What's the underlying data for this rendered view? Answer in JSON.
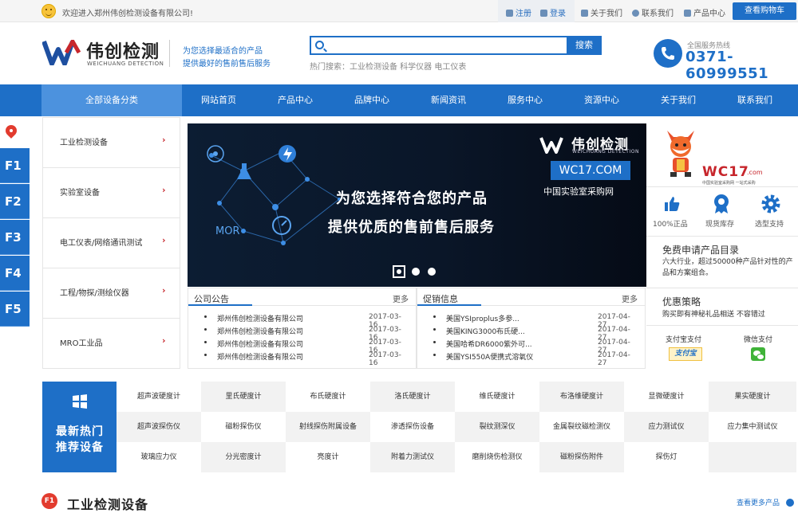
{
  "topbar": {
    "welcome": "欢迎进入郑州伟创检测设备有限公司!",
    "register": "注册",
    "login": "登录",
    "about": "关于我们",
    "contact": "联系我们",
    "products": "产品中心",
    "cart": "查看购物车"
  },
  "header": {
    "logo_cn": "伟创检测",
    "logo_en": "WEICHUANG DETECTION",
    "slogan1": "为您选择最适合的产品",
    "slogan2": "提供最好的售前售后服务",
    "search_placeholder": "",
    "search_button": "搜索",
    "hot_search": "热门搜索：工业检测设备  科学仪器  电工仪表",
    "hotline_label": "全国服务热线",
    "hotline": "0371-60999551"
  },
  "nav": {
    "all": "全部设备分类",
    "items": [
      "网站首页",
      "产品中心",
      "品牌中心",
      "新闻资讯",
      "服务中心",
      "资源中心",
      "关于我们",
      "联系我们"
    ]
  },
  "floors": [
    "F1",
    "F2",
    "F3",
    "F4",
    "F5"
  ],
  "categories": [
    "工业检测设备",
    "实验室设备",
    "电工仪表/网络通讯测试",
    "工程/物探/测绘仪器",
    "MRO工业品"
  ],
  "banner": {
    "brand": "伟创检测",
    "brand_en": "WEICHUANG DETECTION",
    "url": "WC17.COM",
    "sub": "中国实验室采购网",
    "headline1": "为您选择符合您的产品",
    "headline2": "提供优质的售前售后服务",
    "mor": "MOR"
  },
  "notice": {
    "title": "公司公告",
    "more": "更多",
    "items": [
      {
        "text": "郑州伟创检测设备有限公司",
        "date": "2017-03-16"
      },
      {
        "text": "郑州伟创检测设备有限公司",
        "date": "2017-03-16"
      },
      {
        "text": "郑州伟创检测设备有限公司",
        "date": "2017-03-16"
      },
      {
        "text": "郑州伟创检测设备有限公司",
        "date": "2017-03-16"
      }
    ]
  },
  "promo": {
    "title": "促销信息",
    "more": "更多",
    "items": [
      {
        "text": "美国YSIproplus多参...",
        "date": "2017-04-27"
      },
      {
        "text": "美国KING3000布氏硬...",
        "date": "2017-04-27"
      },
      {
        "text": "美国哈希DR6000紫外可...",
        "date": "2017-04-27"
      },
      {
        "text": "美国YSI550A便携式溶氧仪",
        "date": "2017-04-27"
      }
    ]
  },
  "rightside": {
    "wc17": "WC17",
    "wc17_com": ".com",
    "wc17_sub": "中国实验室采购网 一站式采购",
    "features": [
      "100%正品",
      "现货库存",
      "选型支持"
    ],
    "apply_title": "免费申请产品目录",
    "apply_text": "六大行业，超过50000种产品针对性的产品和方案组合。",
    "deal_title": "优惠策略",
    "deal_text": "购买即有神秘礼品相送 不容错过",
    "pay1": "支付宝支付",
    "pay2": "微信支付",
    "alipay_logo": "支付宝"
  },
  "hot": {
    "title1": "最新热门",
    "title2": "推荐设备",
    "rows": [
      [
        "超声波硬度计",
        "里氏硬度计",
        "布氏硬度计",
        "洛氏硬度计",
        "维氏硬度计",
        "布洛维硬度计",
        "显微硬度计",
        "果实硬度计"
      ],
      [
        "超声波探伤仪",
        "磁粉探伤仪",
        "射线探伤附属设备",
        "渗透探伤设备",
        "裂纹测深仪",
        "金属裂纹磁检测仪",
        "应力测试仪",
        "应力集中测试仪"
      ],
      [
        "玻璃应力仪",
        "分光密度计",
        "亮度计",
        "附着力测试仪",
        "磨削烧伤检测仪",
        "磁粉探伤附件",
        "探伤灯"
      ]
    ]
  },
  "f1": {
    "badge": "F1",
    "title": "工业检测设备",
    "more": "查看更多产品"
  },
  "colors": {
    "primary": "#1e6fc7",
    "accent_red": "#c7262c",
    "nav_all": "#4c92de"
  }
}
